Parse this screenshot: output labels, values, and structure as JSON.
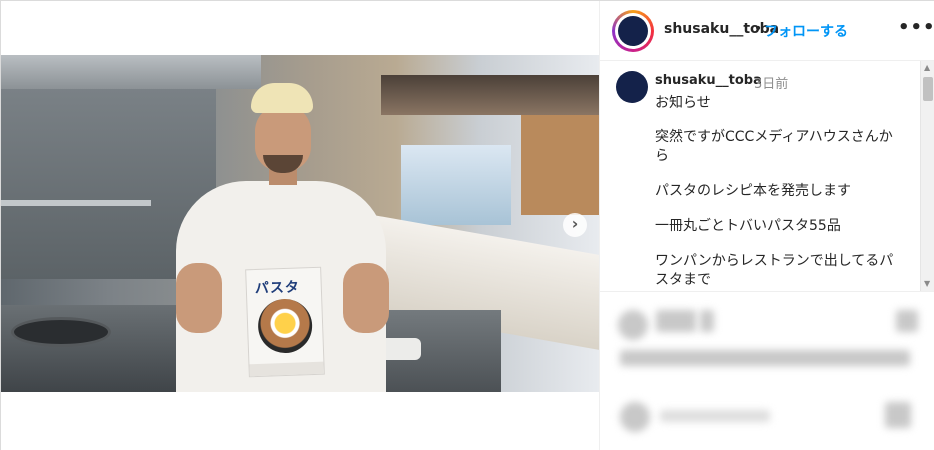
{
  "post": {
    "author": "shusaku__toba",
    "header_separator": "•",
    "follow_label": "フォローする",
    "more_label": "•••",
    "carousel_next": "›"
  },
  "book": {
    "title": "パスタ"
  },
  "caption": {
    "author": "shusaku__toba",
    "time": "3日前",
    "lines": [
      "お知らせ",
      "突然ですがCCCメディアハウスさんか",
      "ら",
      "パスタのレシピ本を発売します",
      "一冊丸ごとトバいパスタ55品",
      "ワンパンからレストランで出してるパ",
      "スタまで"
    ]
  },
  "scrollbar": {
    "up": "▲",
    "down": "▼"
  },
  "colors": {
    "follow_blue": "#0095f6",
    "avatar_navy": "#14224a",
    "muted_gray": "#8e8e8e"
  }
}
